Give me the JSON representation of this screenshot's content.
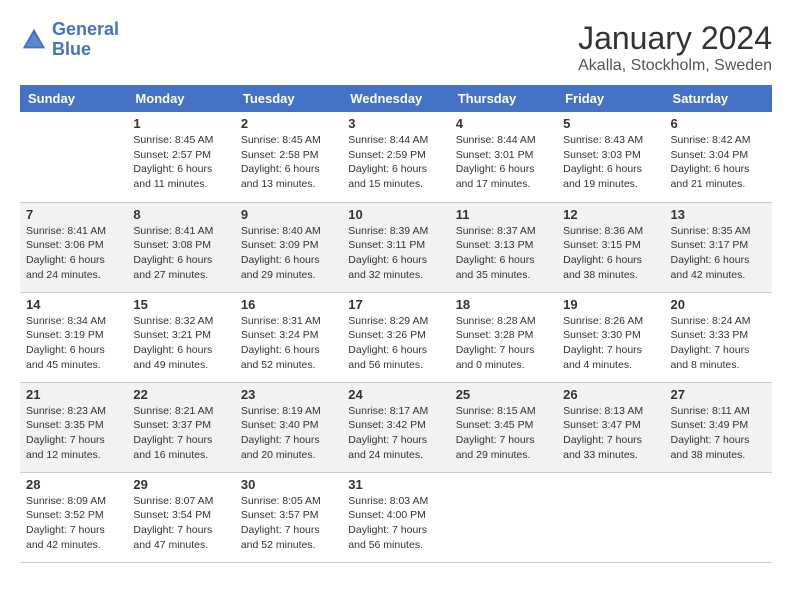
{
  "header": {
    "logo_line1": "General",
    "logo_line2": "Blue",
    "main_title": "January 2024",
    "subtitle": "Akalla, Stockholm, Sweden"
  },
  "days_header": [
    "Sunday",
    "Monday",
    "Tuesday",
    "Wednesday",
    "Thursday",
    "Friday",
    "Saturday"
  ],
  "weeks": [
    [
      {
        "day": "",
        "info": ""
      },
      {
        "day": "1",
        "info": "Sunrise: 8:45 AM\nSunset: 2:57 PM\nDaylight: 6 hours\nand 11 minutes."
      },
      {
        "day": "2",
        "info": "Sunrise: 8:45 AM\nSunset: 2:58 PM\nDaylight: 6 hours\nand 13 minutes."
      },
      {
        "day": "3",
        "info": "Sunrise: 8:44 AM\nSunset: 2:59 PM\nDaylight: 6 hours\nand 15 minutes."
      },
      {
        "day": "4",
        "info": "Sunrise: 8:44 AM\nSunset: 3:01 PM\nDaylight: 6 hours\nand 17 minutes."
      },
      {
        "day": "5",
        "info": "Sunrise: 8:43 AM\nSunset: 3:03 PM\nDaylight: 6 hours\nand 19 minutes."
      },
      {
        "day": "6",
        "info": "Sunrise: 8:42 AM\nSunset: 3:04 PM\nDaylight: 6 hours\nand 21 minutes."
      }
    ],
    [
      {
        "day": "7",
        "info": "Sunrise: 8:41 AM\nSunset: 3:06 PM\nDaylight: 6 hours\nand 24 minutes."
      },
      {
        "day": "8",
        "info": "Sunrise: 8:41 AM\nSunset: 3:08 PM\nDaylight: 6 hours\nand 27 minutes."
      },
      {
        "day": "9",
        "info": "Sunrise: 8:40 AM\nSunset: 3:09 PM\nDaylight: 6 hours\nand 29 minutes."
      },
      {
        "day": "10",
        "info": "Sunrise: 8:39 AM\nSunset: 3:11 PM\nDaylight: 6 hours\nand 32 minutes."
      },
      {
        "day": "11",
        "info": "Sunrise: 8:37 AM\nSunset: 3:13 PM\nDaylight: 6 hours\nand 35 minutes."
      },
      {
        "day": "12",
        "info": "Sunrise: 8:36 AM\nSunset: 3:15 PM\nDaylight: 6 hours\nand 38 minutes."
      },
      {
        "day": "13",
        "info": "Sunrise: 8:35 AM\nSunset: 3:17 PM\nDaylight: 6 hours\nand 42 minutes."
      }
    ],
    [
      {
        "day": "14",
        "info": "Sunrise: 8:34 AM\nSunset: 3:19 PM\nDaylight: 6 hours\nand 45 minutes."
      },
      {
        "day": "15",
        "info": "Sunrise: 8:32 AM\nSunset: 3:21 PM\nDaylight: 6 hours\nand 49 minutes."
      },
      {
        "day": "16",
        "info": "Sunrise: 8:31 AM\nSunset: 3:24 PM\nDaylight: 6 hours\nand 52 minutes."
      },
      {
        "day": "17",
        "info": "Sunrise: 8:29 AM\nSunset: 3:26 PM\nDaylight: 6 hours\nand 56 minutes."
      },
      {
        "day": "18",
        "info": "Sunrise: 8:28 AM\nSunset: 3:28 PM\nDaylight: 7 hours\nand 0 minutes."
      },
      {
        "day": "19",
        "info": "Sunrise: 8:26 AM\nSunset: 3:30 PM\nDaylight: 7 hours\nand 4 minutes."
      },
      {
        "day": "20",
        "info": "Sunrise: 8:24 AM\nSunset: 3:33 PM\nDaylight: 7 hours\nand 8 minutes."
      }
    ],
    [
      {
        "day": "21",
        "info": "Sunrise: 8:23 AM\nSunset: 3:35 PM\nDaylight: 7 hours\nand 12 minutes."
      },
      {
        "day": "22",
        "info": "Sunrise: 8:21 AM\nSunset: 3:37 PM\nDaylight: 7 hours\nand 16 minutes."
      },
      {
        "day": "23",
        "info": "Sunrise: 8:19 AM\nSunset: 3:40 PM\nDaylight: 7 hours\nand 20 minutes."
      },
      {
        "day": "24",
        "info": "Sunrise: 8:17 AM\nSunset: 3:42 PM\nDaylight: 7 hours\nand 24 minutes."
      },
      {
        "day": "25",
        "info": "Sunrise: 8:15 AM\nSunset: 3:45 PM\nDaylight: 7 hours\nand 29 minutes."
      },
      {
        "day": "26",
        "info": "Sunrise: 8:13 AM\nSunset: 3:47 PM\nDaylight: 7 hours\nand 33 minutes."
      },
      {
        "day": "27",
        "info": "Sunrise: 8:11 AM\nSunset: 3:49 PM\nDaylight: 7 hours\nand 38 minutes."
      }
    ],
    [
      {
        "day": "28",
        "info": "Sunrise: 8:09 AM\nSunset: 3:52 PM\nDaylight: 7 hours\nand 42 minutes."
      },
      {
        "day": "29",
        "info": "Sunrise: 8:07 AM\nSunset: 3:54 PM\nDaylight: 7 hours\nand 47 minutes."
      },
      {
        "day": "30",
        "info": "Sunrise: 8:05 AM\nSunset: 3:57 PM\nDaylight: 7 hours\nand 52 minutes."
      },
      {
        "day": "31",
        "info": "Sunrise: 8:03 AM\nSunset: 4:00 PM\nDaylight: 7 hours\nand 56 minutes."
      },
      {
        "day": "",
        "info": ""
      },
      {
        "day": "",
        "info": ""
      },
      {
        "day": "",
        "info": ""
      }
    ]
  ]
}
